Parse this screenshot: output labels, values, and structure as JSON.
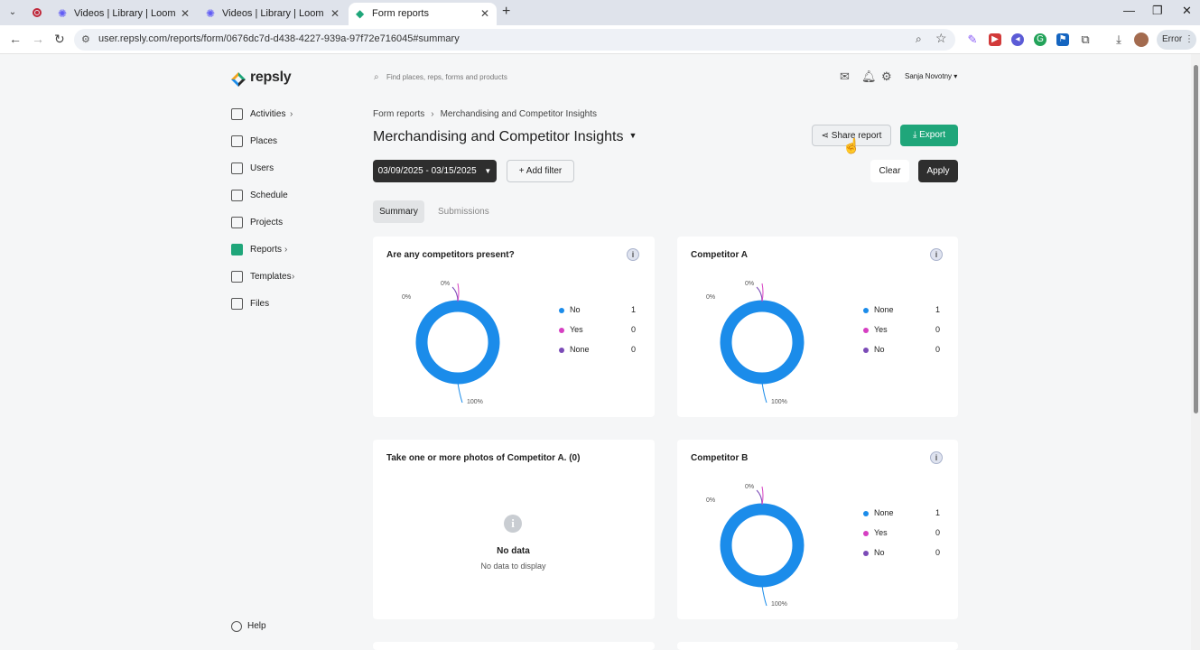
{
  "browser": {
    "tabs": [
      {
        "title": "Videos | Library | Loom"
      },
      {
        "title": "Videos | Library | Loom"
      },
      {
        "title": "Form reports"
      }
    ],
    "url": "user.repsly.com/reports/form/0676dc7d-d438-4227-939a-97f72e716045#summary",
    "error_label": "Error"
  },
  "brand": {
    "name": "repsly",
    "accent": "#1fa67a"
  },
  "search": {
    "placeholder": "Find places, reps, forms and products"
  },
  "user": {
    "name": "Sanja Novotny"
  },
  "sidebar": {
    "items": [
      {
        "label": "Activities",
        "icon": "activities-icon",
        "has_children": true
      },
      {
        "label": "Places",
        "icon": "places-icon",
        "has_children": false
      },
      {
        "label": "Users",
        "icon": "users-icon",
        "has_children": false
      },
      {
        "label": "Schedule",
        "icon": "schedule-icon",
        "has_children": false
      },
      {
        "label": "Projects",
        "icon": "projects-icon",
        "has_children": false
      },
      {
        "label": "Reports",
        "icon": "reports-icon",
        "has_children": true,
        "active": true
      },
      {
        "label": "Templates",
        "icon": "templates-icon",
        "has_children": true
      },
      {
        "label": "Files",
        "icon": "files-icon",
        "has_children": false
      }
    ],
    "help_label": "Help"
  },
  "breadcrumb": {
    "root": "Form reports",
    "current": "Merchandising and Competitor Insights"
  },
  "page": {
    "title": "Merchandising and Competitor Insights"
  },
  "actions": {
    "share_label": "Share report",
    "export_label": "Export",
    "date_range": "03/09/2025 - 03/15/2025",
    "add_filter_label": "Add filter",
    "clear_label": "Clear",
    "apply_label": "Apply"
  },
  "view_tabs": {
    "summary": "Summary",
    "submissions": "Submissions"
  },
  "colors": {
    "blue": "#1b8cea",
    "pink": "#d63fc2",
    "purple": "#7b4bb7"
  },
  "cards": [
    {
      "title": "Are any competitors present?",
      "legend": [
        {
          "name": "No",
          "count": "1",
          "color": "#1b8cea"
        },
        {
          "name": "Yes",
          "count": "0",
          "color": "#d63fc2"
        },
        {
          "name": "None",
          "count": "0",
          "color": "#7b4bb7"
        }
      ],
      "labels": {
        "a": "0%",
        "b": "0%",
        "c": "100%"
      }
    },
    {
      "title": "Competitor A",
      "legend": [
        {
          "name": "None",
          "count": "1",
          "color": "#1b8cea"
        },
        {
          "name": "Yes",
          "count": "0",
          "color": "#d63fc2"
        },
        {
          "name": "No",
          "count": "0",
          "color": "#7b4bb7"
        }
      ],
      "labels": {
        "a": "0%",
        "b": "0%",
        "c": "100%"
      }
    },
    {
      "title": "Take one or more photos of Competitor A. (0)",
      "nodata_title": "No data",
      "nodata_sub": "No data to display"
    },
    {
      "title": "Competitor B",
      "legend": [
        {
          "name": "None",
          "count": "1",
          "color": "#1b8cea"
        },
        {
          "name": "Yes",
          "count": "0",
          "color": "#d63fc2"
        },
        {
          "name": "No",
          "count": "0",
          "color": "#7b4bb7"
        }
      ],
      "labels": {
        "a": "0%",
        "b": "0%",
        "c": "100%"
      }
    }
  ]
}
